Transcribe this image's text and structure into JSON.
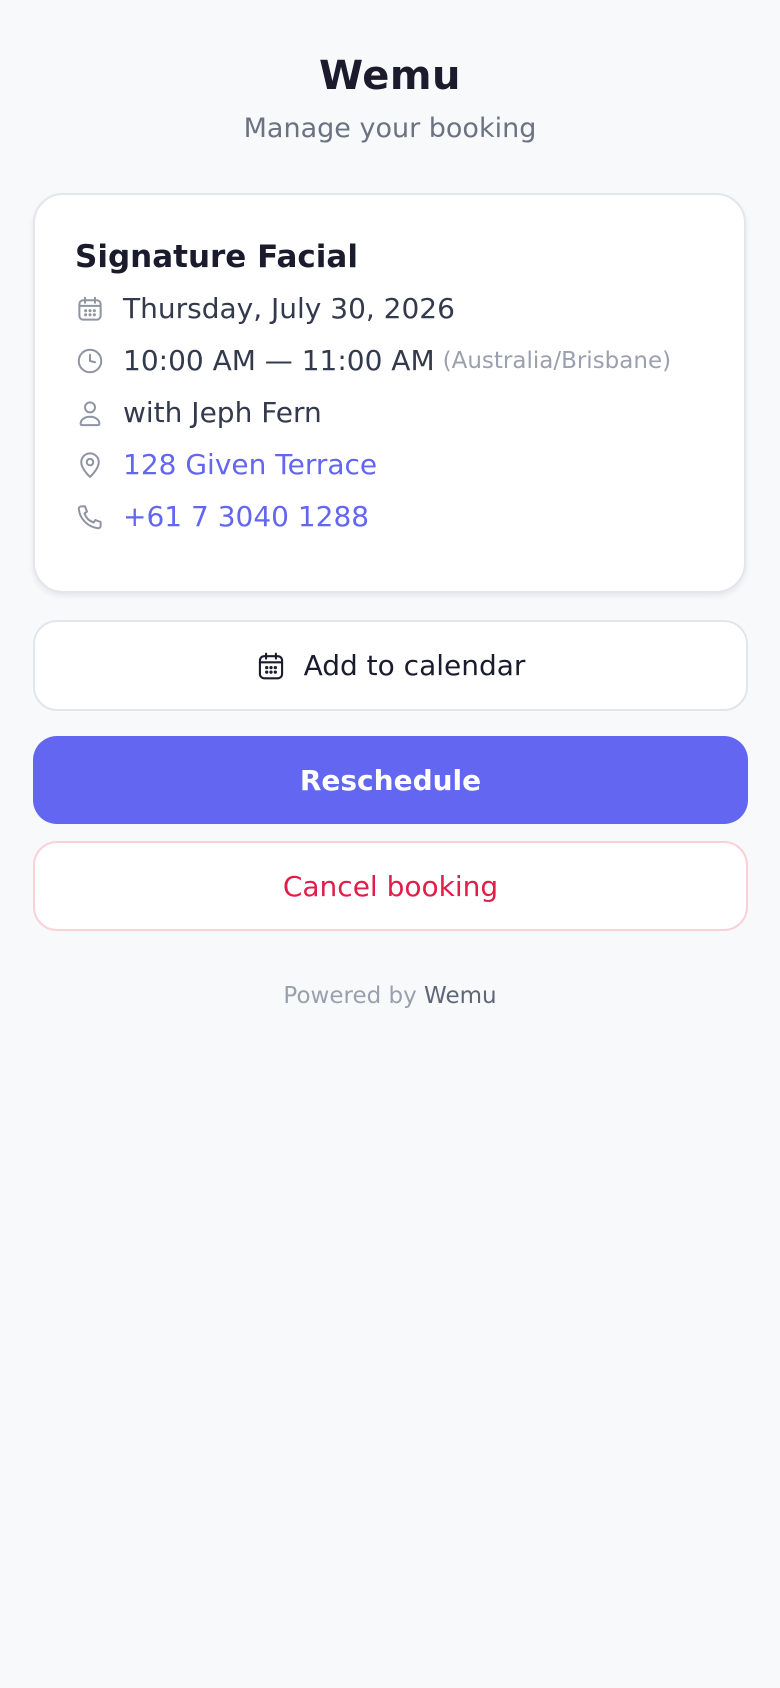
{
  "header": {
    "title": "Wemu",
    "subtitle": "Manage your booking"
  },
  "booking": {
    "service": "Signature Facial",
    "date": "Thursday, July 30, 2026",
    "time": "10:00 AM — 11:00 AM",
    "timezone": "(Australia/Brisbane)",
    "staff": "with Jeph Fern",
    "address": "128 Given Terrace",
    "phone": "+61 7 3040 1288"
  },
  "actions": {
    "add_to_calendar": "Add to calendar",
    "reschedule": "Reschedule",
    "cancel": "Cancel booking"
  },
  "footer": {
    "powered_by": "Powered by",
    "brand": "Wemu"
  },
  "icons": {
    "date": "calendar-icon",
    "time": "clock-icon",
    "staff": "user-icon",
    "address": "map-pin-icon",
    "phone": "phone-icon",
    "add_to_calendar": "calendar-icon"
  },
  "colors": {
    "accent": "#6366f1",
    "danger": "#e11d48",
    "danger_border": "#fbd0d8",
    "background": "#f8f9fb"
  }
}
